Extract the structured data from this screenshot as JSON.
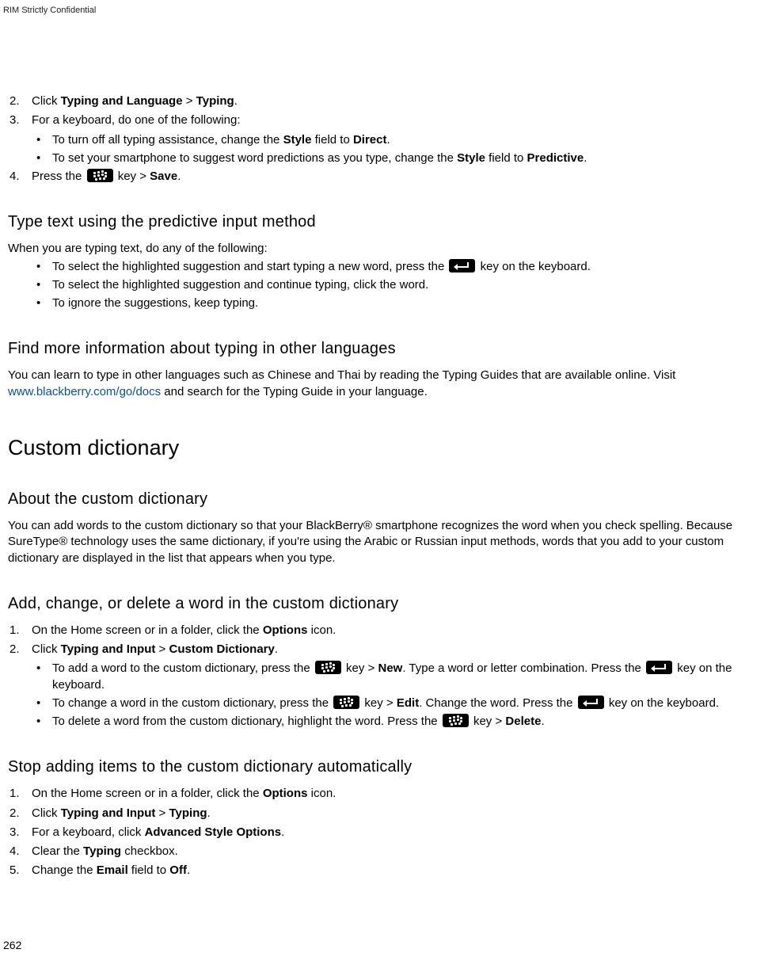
{
  "header": {
    "confidential": "RIM Strictly Confidential"
  },
  "page_number": "262",
  "list1": {
    "item2": {
      "num": "2.",
      "t1": "Click ",
      "b1": "Typing and Language",
      "t2": " > ",
      "b2": "Typing",
      "t3": "."
    },
    "item3": {
      "num": "3.",
      "text": "For a keyboard, do one of the following:"
    },
    "item3_b1": {
      "t1": "To turn off all typing assistance, change the ",
      "b1": "Style",
      "t2": " field to ",
      "b2": "Direct",
      "t3": "."
    },
    "item3_b2": {
      "t1": "To set your smartphone to suggest word predictions as you type, change the ",
      "b1": "Style",
      "t2": " field to ",
      "b2": "Predictive",
      "t3": "."
    },
    "item4": {
      "num": "4.",
      "t1": "Press the ",
      "t2": " key > ",
      "b1": "Save",
      "t3": "."
    }
  },
  "sec_predictive": {
    "title": "Type text using the predictive input method",
    "intro": "When you are typing text, do any of the following:",
    "b1_t1": "To select the highlighted suggestion and start typing a new word, press the ",
    "b1_t2": " key on the keyboard.",
    "b2": "To select the highlighted suggestion and continue typing, click the word.",
    "b3": "To ignore the suggestions, keep typing."
  },
  "sec_lang": {
    "title": "Find more information about typing in other languages",
    "p_t1": "You can learn to type in other languages such as Chinese and Thai by reading the Typing Guides that are available online. Visit ",
    "link": "www.blackberry.com/go/docs",
    "p_t2": " and search for the Typing Guide in your language."
  },
  "sec_custom": {
    "h1": "Custom dictionary",
    "about_h2": "About the custom dictionary",
    "about_p": "You can add words to the custom dictionary so that your BlackBerry® smartphone recognizes the word when you check spelling. Because SureType® technology uses the same dictionary, if you're using the Arabic or Russian input methods, words that you add to your custom dictionary are displayed in the list that appears when you type.",
    "add_h2": "Add, change, or delete a word in the custom dictionary",
    "add_l1": {
      "num": "1.",
      "t1": "On the Home screen or in a folder, click the ",
      "b1": "Options",
      "t2": " icon."
    },
    "add_l2": {
      "num": "2.",
      "t1": "Click ",
      "b1": "Typing and Input",
      "t2": " > ",
      "b2": "Custom Dictionary",
      "t3": "."
    },
    "add_b1": {
      "t1": "To add a word to the custom dictionary, press the ",
      "t2": " key > ",
      "b1": "New",
      "t3": ". Type a word or letter combination. Press the ",
      "t4": " key on the keyboard."
    },
    "add_b2": {
      "t1": "To change a word in the custom dictionary, press the ",
      "t2": " key > ",
      "b1": "Edit",
      "t3": ". Change the word. Press the ",
      "t4": " key on the keyboard."
    },
    "add_b3": {
      "t1": "To delete a word from the custom dictionary, highlight the word. Press the ",
      "t2": " key > ",
      "b1": "Delete",
      "t3": "."
    },
    "stop_h2": "Stop adding items to the custom dictionary automatically",
    "stop_l1": {
      "num": "1.",
      "t1": "On the Home screen or in a folder, click the ",
      "b1": "Options",
      "t2": " icon."
    },
    "stop_l2": {
      "num": "2.",
      "t1": "Click ",
      "b1": "Typing and Input",
      "t2": " > ",
      "b2": "Typing",
      "t3": "."
    },
    "stop_l3": {
      "num": "3.",
      "t1": "For a keyboard, click ",
      "b1": "Advanced Style Options",
      "t2": "."
    },
    "stop_l4": {
      "num": "4.",
      "t1": "Clear the ",
      "b1": "Typing",
      "t2": " checkbox."
    },
    "stop_l5": {
      "num": "5.",
      "t1": "Change the ",
      "b1": "Email",
      "t2": " field to ",
      "b2": "Off",
      "t3": "."
    }
  }
}
